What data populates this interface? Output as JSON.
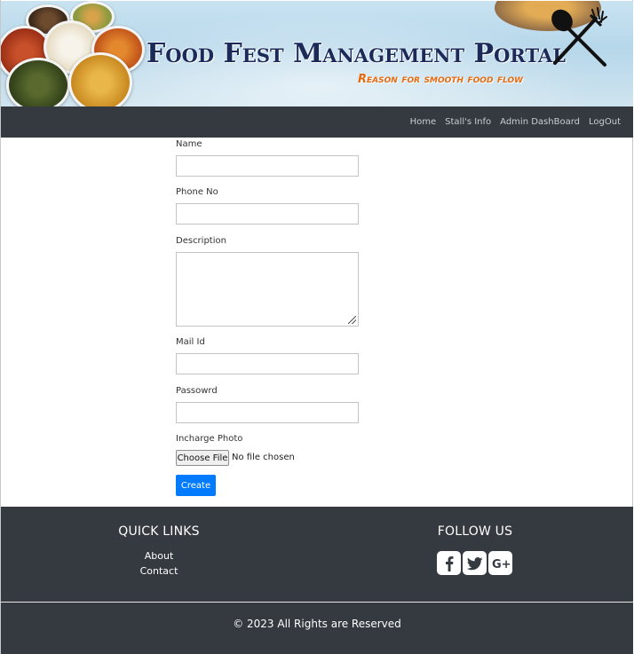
{
  "header": {
    "title": "Food Fest Management Portal",
    "tagline": "Reason for smooth food flow"
  },
  "nav": {
    "items": [
      {
        "label": "Home"
      },
      {
        "label": "Stall's Info"
      },
      {
        "label": "Admin DashBoard"
      },
      {
        "label": "LogOut"
      }
    ]
  },
  "form": {
    "name_label": "Name",
    "name_value": "",
    "phone_label": "Phone No",
    "phone_value": "",
    "description_label": "Description",
    "description_value": "",
    "mail_label": "Mail Id",
    "mail_value": "",
    "password_label": "Passowrd",
    "password_value": "",
    "photo_label": "Incharge Photo",
    "choose_file_label": "Choose File",
    "no_file_text": "No file chosen",
    "create_label": "Create"
  },
  "footer": {
    "quick_links_title": "QUICK LINKS",
    "quick_links": [
      {
        "label": "About"
      },
      {
        "label": "Contact"
      }
    ],
    "follow_title": "FOLLOW US",
    "social_icons": [
      "facebook-icon",
      "twitter-icon",
      "google-plus-icon"
    ],
    "copyright": "© 2023 All Rights are Reserved"
  },
  "colors": {
    "navbar_bg": "#343a40",
    "primary_button": "#007bff",
    "title_color": "#1c2a5a",
    "tagline_color": "#e66a10"
  }
}
